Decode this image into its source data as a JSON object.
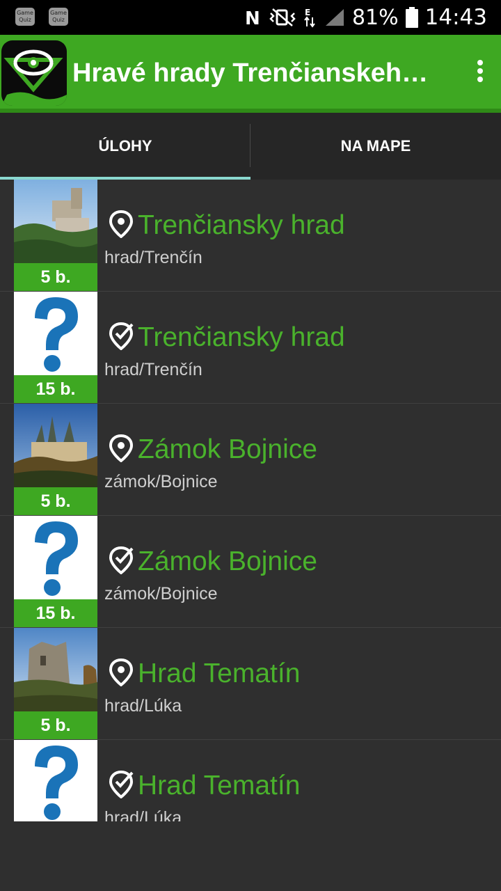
{
  "status_bar": {
    "notif_icons": [
      "game-quiz-notification-icon",
      "game-quiz-notification-icon"
    ],
    "notif_text": "Game Quiz",
    "icons": [
      "nfc-icon",
      "vibrate-icon",
      "data-arrows-icon",
      "signal-icon"
    ],
    "data_label": "E",
    "battery": "81%",
    "time": "14:43"
  },
  "toolbar": {
    "title": "Hravé hrady Trenčianskeho kraja",
    "menu_icon": "overflow-menu-icon",
    "brand_color": "#3ea822"
  },
  "tabs": [
    {
      "label": "ÚLOHY",
      "selected": true
    },
    {
      "label": "NA MAPE",
      "selected": false
    }
  ],
  "tasks": [
    {
      "title": "Trenčiansky hrad",
      "subtitle": "hrad/Trenčín",
      "points": "5 b.",
      "icon": "location-pin-icon",
      "thumb": "castle-photo-trencin"
    },
    {
      "title": "Trenčiansky hrad",
      "subtitle": "hrad/Trenčín",
      "points": "15 b.",
      "icon": "checkmark-badge-icon",
      "thumb": "question-mark"
    },
    {
      "title": "Zámok Bojnice",
      "subtitle": "zámok/Bojnice",
      "points": "5 b.",
      "icon": "location-pin-icon",
      "thumb": "castle-photo-bojnice"
    },
    {
      "title": "Zámok Bojnice",
      "subtitle": "zámok/Bojnice",
      "points": "15 b.",
      "icon": "checkmark-badge-icon",
      "thumb": "question-mark"
    },
    {
      "title": "Hrad Tematín",
      "subtitle": "hrad/Lúka",
      "points": "5 b.",
      "icon": "location-pin-icon",
      "thumb": "castle-photo-tematin"
    },
    {
      "title": "Hrad Tematín",
      "subtitle": "hrad/Lúka",
      "points": "",
      "icon": "checkmark-badge-icon",
      "thumb": "question-mark"
    }
  ]
}
